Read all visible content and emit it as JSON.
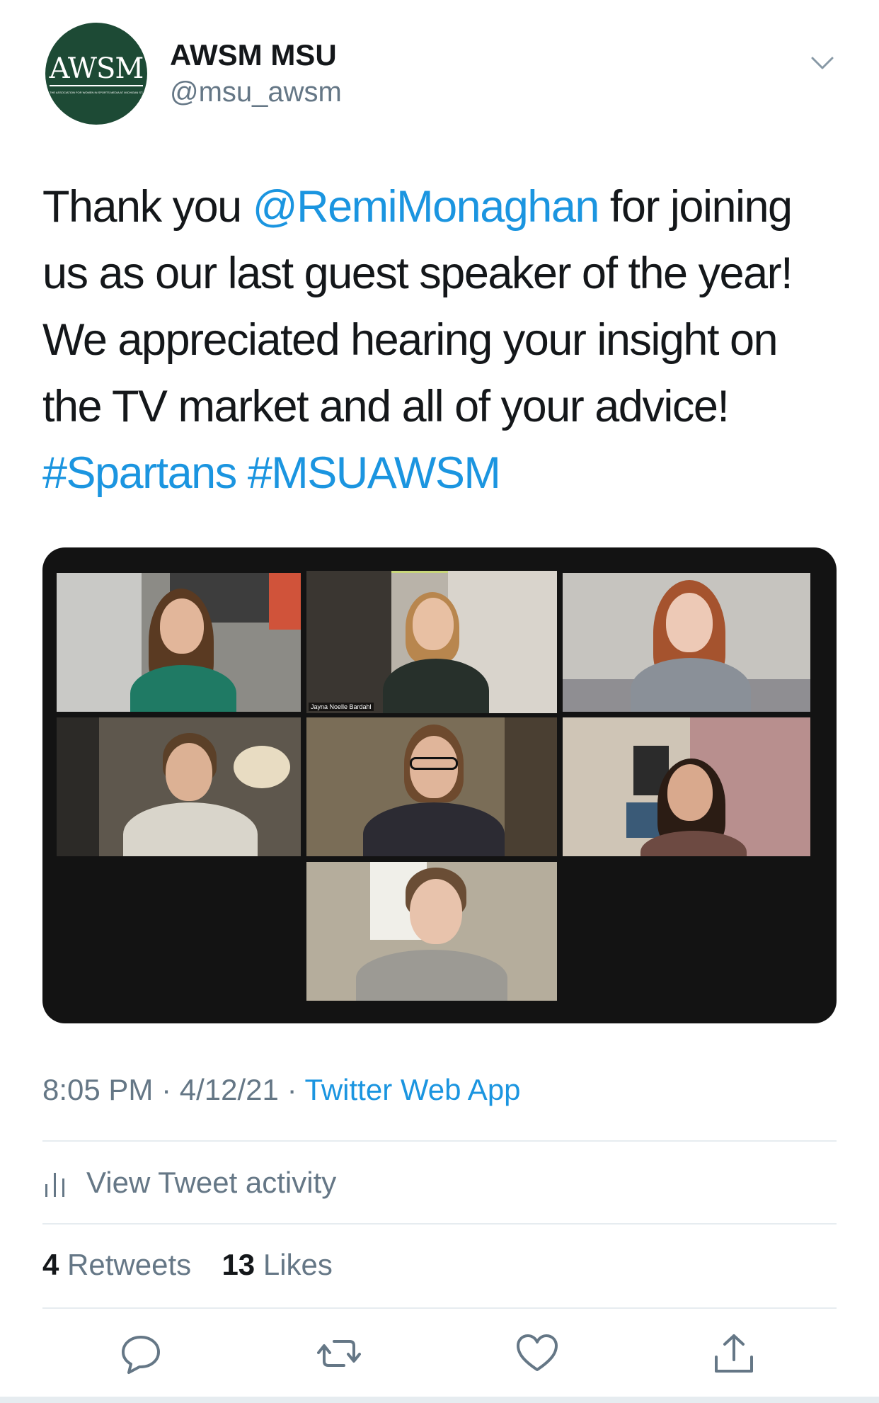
{
  "account": {
    "display_name": "AWSM MSU",
    "handle": "@msu_awsm",
    "avatar_logo_text": "AWSM",
    "avatar_tagline": "THE ASSOCIATION FOR WOMEN IN SPORTS MEDIA AT MICHIGAN STATE UNIVERSITY"
  },
  "tweet": {
    "text_before": "Thank you ",
    "mention": "@RemiMonaghan",
    "text_after": " for joining us as our last guest speaker of the year! We appreciated hearing your insight on the TV market and all of your advice! ",
    "hashtag_1": "#Spartans",
    "hashtag_2": "#MSUAWSM"
  },
  "media": {
    "participant_label": "Jayna Noelle Bardahl"
  },
  "meta": {
    "time": "8:05 PM",
    "separator": "·",
    "date": "4/12/21",
    "source": "Twitter Web App"
  },
  "activity": {
    "label": "View Tweet activity",
    "icon": "bar-chart-icon"
  },
  "counts": {
    "retweets_count": "4",
    "retweets_label": "Retweets",
    "likes_count": "13",
    "likes_label": "Likes"
  },
  "actions": {
    "reply_icon": "reply-icon",
    "retweet_icon": "retweet-icon",
    "like_icon": "heart-icon",
    "share_icon": "share-icon"
  },
  "colors": {
    "link": "#1b95e0",
    "secondary_text": "#657786",
    "primary_text": "#14171a",
    "divider": "#e6ecf0",
    "avatar_bg": "#1d4a35"
  }
}
